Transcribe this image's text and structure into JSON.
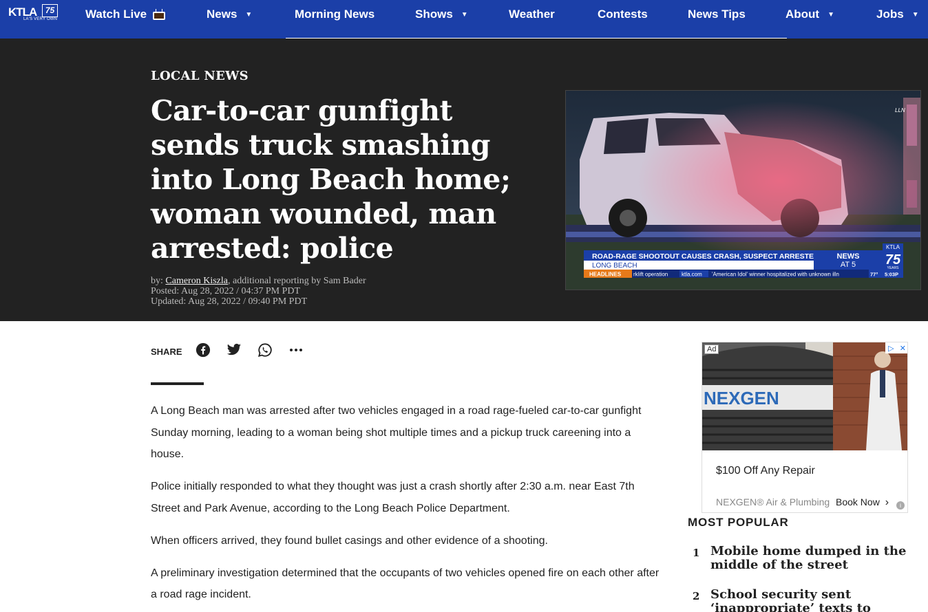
{
  "nav": {
    "logo_text": "KTLA",
    "logo_badge": "75",
    "logo_tagline": "LA'S VERY OWN",
    "items": [
      {
        "label": "Watch Live",
        "icon": "tv-icon"
      },
      {
        "label": "News",
        "dropdown": true
      },
      {
        "label": "Morning News"
      },
      {
        "label": "Shows",
        "dropdown": true
      },
      {
        "label": "Weather"
      },
      {
        "label": "Contests"
      },
      {
        "label": "News Tips"
      },
      {
        "label": "About",
        "dropdown": true
      },
      {
        "label": "Jobs",
        "dropdown": true
      }
    ]
  },
  "article": {
    "kicker": "LOCAL NEWS",
    "headline": "Car-to-car gunfight sends truck smashing into Long Beach home; woman wounded, man arrested: police",
    "byline_prefix": "by: ",
    "author": "Cameron Kiszla",
    "byline_suffix": ", additional reporting by Sam Bader",
    "posted": "Posted: Aug 28, 2022 / 04:37 PM PDT",
    "updated": "Updated: Aug 28, 2022 / 09:40 PM PDT",
    "paragraphs": [
      "A Long Beach man was arrested after two vehicles engaged in a road rage-fueled car-to-car gunfight Sunday morning, leading to a woman being shot multiple times and a pickup truck careening into a house.",
      "Police initially responded to what they thought was just a crash shortly after 2:30 a.m. near East 7th Street and Park Avenue, according to the Long Beach Police Department.",
      "When officers arrived, they found bullet casings and other evidence of a shooting.",
      "A preliminary investigation determined that the occupants of two vehicles opened fire on each other after a road rage incident."
    ]
  },
  "video": {
    "watermark": "LLN",
    "lower_third": "ROAD-RAGE SHOOTOUT CAUSES CRASH, SUSPECT ARRESTED",
    "location": "LONG BEACH",
    "ticker_label": "HEADLINES",
    "ticker_text": "rklift operation",
    "ticker_site": "ktla.com",
    "ticker_text2": "'American Idol' winner hospitalized with unknown illn",
    "show_name_1": "NEWS",
    "show_name_2": "AT 5",
    "station": "KTLA",
    "station_badge": "75",
    "station_years": "YEARS",
    "temp": "77°",
    "time": "5:03P"
  },
  "share": {
    "label": "SHARE",
    "buttons": [
      "facebook-icon",
      "twitter-icon",
      "whatsapp-icon",
      "more-icon"
    ]
  },
  "ad": {
    "mark": "Ad",
    "brand_logo": "NEXGEN",
    "offer": "$100 Off Any Repair",
    "brand": "NEXGEN® Air & Plumbing",
    "cta": "Book Now"
  },
  "popular": {
    "title": "MOST POPULAR",
    "items": [
      {
        "num": "1",
        "title": "Mobile home dumped in the middle of the street"
      },
      {
        "num": "2",
        "title": "School security sent ‘inappropriate’ texts to minor: …"
      }
    ]
  }
}
